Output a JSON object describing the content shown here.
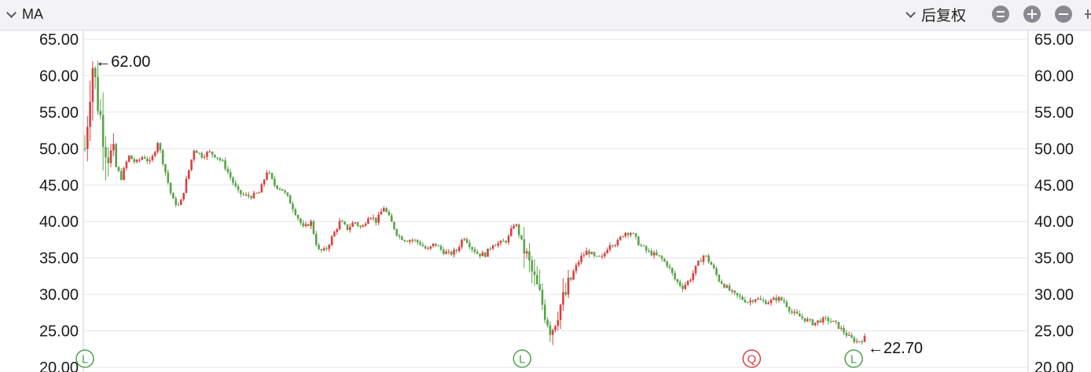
{
  "toolbar": {
    "ma_label": "MA",
    "adjust_label": "后复权",
    "icons": [
      "chevron-down-icon",
      "equal-icon",
      "plus-icon",
      "minus-icon"
    ]
  },
  "chart_data": {
    "type": "candlestick",
    "ylim": [
      20,
      65
    ],
    "yticks": [
      "65.00",
      "60.00",
      "55.00",
      "50.00",
      "45.00",
      "40.00",
      "35.00",
      "30.00",
      "25.00",
      "20.00"
    ],
    "grid": true,
    "colors": {
      "up": "#d9403e",
      "down": "#5aa34a"
    },
    "close_trend": [
      [
        0,
        50
      ],
      [
        2,
        62
      ],
      [
        4,
        55
      ],
      [
        6,
        50
      ],
      [
        8,
        48
      ],
      [
        10,
        46
      ],
      [
        12,
        49
      ],
      [
        14,
        48
      ],
      [
        16,
        49
      ],
      [
        18,
        48
      ],
      [
        20,
        51
      ],
      [
        22,
        47
      ],
      [
        24,
        43
      ],
      [
        26,
        42
      ],
      [
        28,
        46
      ],
      [
        30,
        50
      ],
      [
        32,
        49
      ],
      [
        34,
        49.5
      ],
      [
        36,
        49
      ],
      [
        38,
        48
      ],
      [
        40,
        46
      ],
      [
        42,
        44
      ],
      [
        44,
        43.5
      ],
      [
        46,
        43.5
      ],
      [
        48,
        44
      ],
      [
        50,
        47
      ],
      [
        52,
        45
      ],
      [
        54,
        44.5
      ],
      [
        56,
        43
      ],
      [
        58,
        41
      ],
      [
        60,
        39
      ],
      [
        62,
        40
      ],
      [
        64,
        36
      ],
      [
        66,
        36
      ],
      [
        68,
        38
      ],
      [
        70,
        40
      ],
      [
        72,
        39
      ],
      [
        74,
        40
      ],
      [
        76,
        39
      ],
      [
        78,
        41
      ],
      [
        80,
        40
      ],
      [
        82,
        42
      ],
      [
        84,
        40
      ],
      [
        86,
        38
      ],
      [
        88,
        37.5
      ],
      [
        90,
        37.5
      ],
      [
        92,
        37
      ],
      [
        94,
        36
      ],
      [
        96,
        37
      ],
      [
        98,
        36
      ],
      [
        100,
        35.5
      ],
      [
        102,
        36
      ],
      [
        104,
        38
      ],
      [
        106,
        36.5
      ],
      [
        108,
        35.5
      ],
      [
        110,
        35.5
      ],
      [
        112,
        37
      ],
      [
        114,
        37
      ],
      [
        116,
        37.5
      ],
      [
        118,
        40
      ],
      [
        120,
        37
      ],
      [
        122,
        34
      ],
      [
        124,
        31
      ],
      [
        126,
        28
      ],
      [
        128,
        25
      ],
      [
        130,
        28
      ],
      [
        132,
        30
      ],
      [
        134,
        33
      ],
      [
        136,
        35
      ],
      [
        138,
        36
      ],
      [
        140,
        35
      ],
      [
        142,
        35
      ],
      [
        144,
        37
      ],
      [
        146,
        37
      ],
      [
        148,
        38.5
      ],
      [
        150,
        38.5
      ],
      [
        152,
        37
      ],
      [
        154,
        36
      ],
      [
        156,
        35.5
      ],
      [
        158,
        35
      ],
      [
        160,
        34
      ],
      [
        162,
        32
      ],
      [
        164,
        31
      ],
      [
        166,
        32
      ],
      [
        168,
        34
      ],
      [
        170,
        35.5
      ],
      [
        172,
        34
      ],
      [
        174,
        32
      ],
      [
        176,
        31
      ],
      [
        178,
        30
      ],
      [
        180,
        29.5
      ],
      [
        182,
        29
      ],
      [
        184,
        29.5
      ],
      [
        186,
        29
      ],
      [
        188,
        29
      ],
      [
        190,
        29.5
      ],
      [
        192,
        29
      ],
      [
        194,
        27.5
      ],
      [
        196,
        27
      ],
      [
        198,
        26.5
      ],
      [
        200,
        26
      ],
      [
        202,
        26.5
      ],
      [
        204,
        26.5
      ],
      [
        206,
        26
      ],
      [
        208,
        25
      ],
      [
        210,
        24
      ],
      [
        212,
        23.5
      ],
      [
        214,
        24
      ]
    ],
    "annotations": [
      {
        "label": "←62.00",
        "x": 2,
        "y": 62
      },
      {
        "label": "←22.70",
        "x": 214,
        "y": 22.7
      }
    ],
    "event_markers": [
      {
        "label": "L",
        "x": 0,
        "color": "#4aa34a"
      },
      {
        "label": "L",
        "x": 120,
        "color": "#4aa34a"
      },
      {
        "label": "Q",
        "x": 183,
        "color": "#d9403e"
      },
      {
        "label": "L",
        "x": 211,
        "color": "#4aa34a"
      }
    ]
  }
}
